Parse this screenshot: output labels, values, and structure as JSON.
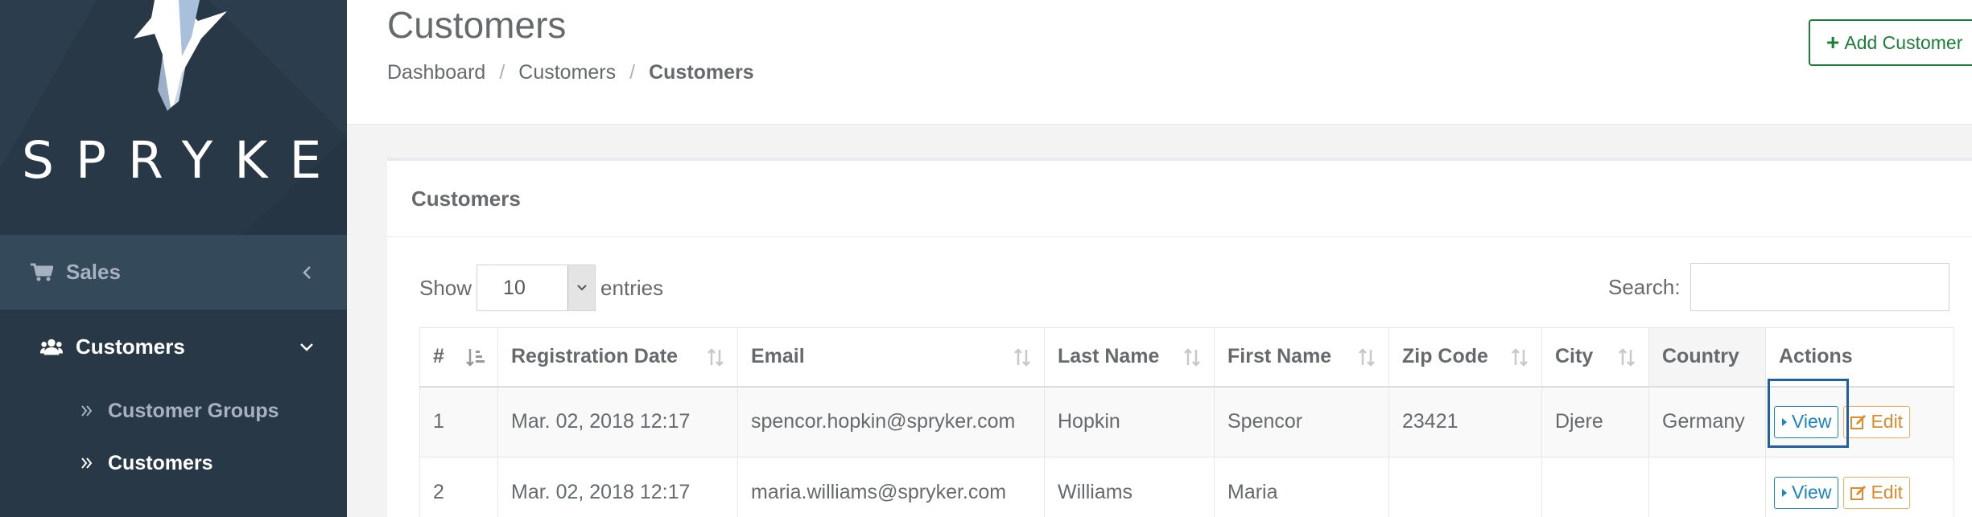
{
  "sidebar": {
    "logo_text": "SPRYKER",
    "sales_label": "Sales",
    "customers_label": "Customers",
    "sub_items": [
      "Customer Groups",
      "Customers"
    ]
  },
  "header": {
    "title": "Customers",
    "breadcrumb": [
      "Dashboard",
      "Customers",
      "Customers"
    ],
    "add_button": "Add Customer"
  },
  "card": {
    "title": "Customers",
    "show_label": "Show",
    "entries_value": "10",
    "entries_label": "entries",
    "search_label": "Search:",
    "search_value": ""
  },
  "table": {
    "columns": [
      "#",
      "Registration Date",
      "Email",
      "Last Name",
      "First Name",
      "Zip Code",
      "City",
      "Country",
      "Actions"
    ],
    "rows": [
      {
        "id": "1",
        "date": "Mar. 02, 2018 12:17",
        "email": "spencor.hopkin@spryker.com",
        "last": "Hopkin",
        "first": "Spencor",
        "zip": "23421",
        "city": "Djere",
        "country": "Germany"
      },
      {
        "id": "2",
        "date": "Mar. 02, 2018 12:17",
        "email": "maria.williams@spryker.com",
        "last": "Williams",
        "first": "Maria",
        "zip": "",
        "city": "",
        "country": ""
      }
    ],
    "view_label": "View",
    "edit_label": "Edit"
  },
  "colors": {
    "sidebar_bg": "#2f4050",
    "accent_green": "#1a7f37",
    "view_blue": "#1c84c6",
    "edit_orange": "#f8ac59"
  }
}
